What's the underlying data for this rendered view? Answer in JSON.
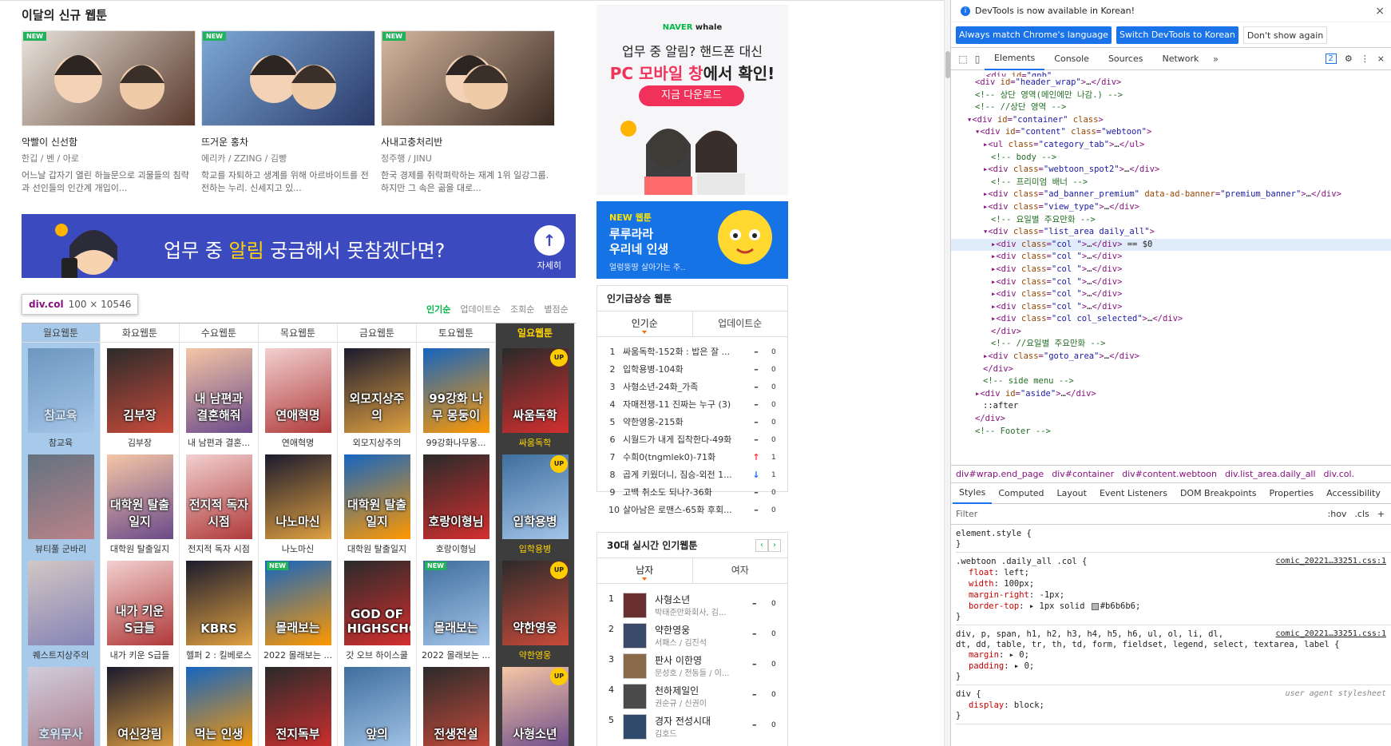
{
  "new_section": {
    "title": "이달의 신규 웹툰",
    "items": [
      {
        "badge": "NEW",
        "title": "악빨이 신선함",
        "author": "한깁 / 벤 / 아로",
        "desc": "어느날 갑자기 열린 하늘문으로 괴물들의 침략과 선인들의 인간계 개입이..."
      },
      {
        "badge": "NEW",
        "title": "뜨거운 홍차",
        "author": "에리카 / ZZING / 김빵",
        "desc": "학교를 자퇴하고 생계를 위해 아르바이트를 전전하는 누리. 신세지고 있..."
      },
      {
        "badge": "NEW",
        "title": "사내고충처리반",
        "author": "정주행 / JINU",
        "desc": "한국 경제를 쥐락펴락하는 재계 1위 일강그룹. 하지만 그 속은 곪을 대로..."
      }
    ]
  },
  "banner": {
    "text_pre": "업무 중 ",
    "text_hl": "알림",
    "text_post": " 궁금해서 못참겠다면?",
    "button_label": "자세히",
    "button_icon": "↑"
  },
  "tooltip": {
    "name": "div.col",
    "size": "100 × 10546"
  },
  "sort_tabs": [
    "인기순",
    "업데이트순",
    "조회순",
    "별점순"
  ],
  "weekdays": [
    {
      "label": "월요웹툰",
      "items": [
        {
          "cap": "참교육",
          "art": "참교육"
        },
        {
          "cap": "뷰티풀 군바리",
          "art": ""
        },
        {
          "cap": "퀘스트지상주의",
          "art": ""
        },
        {
          "cap": "",
          "art": "호위무사"
        }
      ]
    },
    {
      "label": "화요웹툰",
      "items": [
        {
          "cap": "김부장",
          "art": "김부장"
        },
        {
          "cap": "대학원 탈출일지",
          "art": "대학원 탈출일지"
        },
        {
          "cap": "내가 키운 S급들",
          "art": "내가 키운 S급들"
        },
        {
          "cap": "",
          "art": "여신강림"
        }
      ]
    },
    {
      "label": "수요웹툰",
      "items": [
        {
          "cap": "내 남편과 결혼...",
          "art": "내 남편과 결혼해줘"
        },
        {
          "cap": "전지적 독자 시점",
          "art": "전지적 독자 시점"
        },
        {
          "cap": "헬퍼 2 : 킬베로스",
          "art": "KBRS"
        },
        {
          "cap": "",
          "art": "먹는 인생"
        }
      ]
    },
    {
      "label": "목요웹툰",
      "items": [
        {
          "cap": "연애혁명",
          "art": "연애혁명"
        },
        {
          "cap": "나노마신",
          "art": "나노마신"
        },
        {
          "cap": "2022 몰래보는 ...",
          "art": "몰래보는"
        },
        {
          "cap": "",
          "art": "전지독부"
        }
      ]
    },
    {
      "label": "금요웹툰",
      "items": [
        {
          "cap": "외모지상주의",
          "art": "외모지상주의"
        },
        {
          "cap": "대학원 탈출일지",
          "art": "대학원 탈출일지"
        },
        {
          "cap": "갓 오브 하이스쿨",
          "art": "GOD OF HIGHSCHOOL"
        },
        {
          "cap": "",
          "art": "앞의"
        }
      ]
    },
    {
      "label": "토요웹툰",
      "items": [
        {
          "cap": "99강화나무몽...",
          "art": "99강화 나무 몽둥이"
        },
        {
          "cap": "호랑이형님",
          "art": "호랑이형님"
        },
        {
          "cap": "2022 몰래보는 ...",
          "art": "몰래보는"
        },
        {
          "cap": "",
          "art": "전생전설"
        }
      ]
    },
    {
      "label": "일요웹툰",
      "items": [
        {
          "cap": "싸움독학",
          "art": "싸움독학"
        },
        {
          "cap": "입학용병",
          "art": "입학용병"
        },
        {
          "cap": "약한영웅",
          "art": "약한영웅"
        },
        {
          "cap": "",
          "art": "사형소년"
        }
      ]
    }
  ],
  "whale_ad": {
    "brand_pre": "NAVER",
    "brand": "whale",
    "line1": "업무 중 알림? 핸드폰 대신",
    "line2_red": "PC 모바일 창",
    "line2_rest": "에서 확인!",
    "download": "지금 다운로드"
  },
  "promo": {
    "tag": "NEW 웹툰",
    "title1": "루루라라",
    "title2": "우리네 인생",
    "sub": "얼렁뚱땅 살아가는 주.."
  },
  "rising": {
    "title": "인기급상승 웹툰",
    "tabs": [
      "인기순",
      "업데이트순"
    ],
    "rows": [
      {
        "n": "1",
        "t": "싸움독학-152화 : 밥은 잘 ...",
        "ch": "–",
        "cnt": "0"
      },
      {
        "n": "2",
        "t": "입학용병-104화",
        "ch": "–",
        "cnt": "0"
      },
      {
        "n": "3",
        "t": "사형소년-24화_가족",
        "ch": "–",
        "cnt": "0"
      },
      {
        "n": "4",
        "t": "자매전쟁-11 진짜는 누구 (3)",
        "ch": "–",
        "cnt": "0"
      },
      {
        "n": "5",
        "t": "약한영웅-215화",
        "ch": "–",
        "cnt": "0"
      },
      {
        "n": "6",
        "t": "시월드가 내게 집착한다-49화",
        "ch": "–",
        "cnt": "0"
      },
      {
        "n": "7",
        "t": "수희0(tngmlek0)-71화",
        "ch": "↑",
        "cnt": "1"
      },
      {
        "n": "8",
        "t": "곱게 키웠더니, 짐승-외전 1...",
        "ch": "↓",
        "cnt": "1"
      },
      {
        "n": "9",
        "t": "고백 취소도 되나?-36화",
        "ch": "–",
        "cnt": "0"
      },
      {
        "n": "10",
        "t": "살아남은 로맨스-65화 후회...",
        "ch": "–",
        "cnt": "0"
      }
    ]
  },
  "age30": {
    "title": "30대 실시간 인기웹툰",
    "prev": "‹",
    "next": "›",
    "tabs": [
      "남자",
      "여자"
    ],
    "rows": [
      {
        "n": "1",
        "t": "사형소년",
        "a": "박태준만화회사, 김...",
        "ch": "–",
        "cnt": "0"
      },
      {
        "n": "2",
        "t": "약한영웅",
        "a": "서패스 / 김진석",
        "ch": "–",
        "cnt": "0"
      },
      {
        "n": "3",
        "t": "판사 이한영",
        "a": "문성호 / 전동들 / 이...",
        "ch": "–",
        "cnt": "0"
      },
      {
        "n": "4",
        "t": "천하제일인",
        "a": "권순규 / 신권이",
        "ch": "–",
        "cnt": "0"
      },
      {
        "n": "5",
        "t": "경자 전성시대",
        "a": "김호드",
        "ch": "–",
        "cnt": "0"
      }
    ]
  },
  "devtools": {
    "info": "DevTools is now available in Korean!",
    "info_icon": "i",
    "btn_match": "Always match Chrome's language",
    "btn_switch": "Switch DevTools to Korean",
    "btn_dont": "Don't show again",
    "close_icon": "×",
    "tabs": [
      "Elements",
      "Console",
      "Sources",
      "Network"
    ],
    "more": "»",
    "issues": "2",
    "tree": [
      {
        "html": "<span class='tg'>&lt;div</span> <span class='at'>id</span>=<span class='av'>\"header_wrap\"</span><span class='tg'>&gt;</span><span class='tx'>…</span><span class='tg'>&lt;/div&gt;</span>",
        "indent": 3
      },
      {
        "html": "<span class='cm'>&lt;!-- 상단 영역(메인에만 나감.) --&gt;</span>",
        "indent": 3
      },
      {
        "html": "<span class='cm'>&lt;!-- //상단 영역 --&gt;</span>",
        "indent": 3
      },
      {
        "html": "<span class='tg'>▾&lt;div</span> <span class='at'>id</span>=<span class='av'>\"container\"</span> <span class='at'>class</span><span class='tg'>&gt;</span>",
        "indent": 2
      },
      {
        "html": "<span class='tg'>▾&lt;div</span> <span class='at'>id</span>=<span class='av'>\"content\"</span> <span class='at'>class</span>=<span class='av'>\"webtoon\"</span><span class='tg'>&gt;</span>",
        "indent": 3
      },
      {
        "html": "<span class='tg'>▸&lt;ul</span> <span class='at'>class</span>=<span class='av'>\"category_tab\"</span><span class='tg'>&gt;</span><span class='tx'>…</span><span class='tg'>&lt;/ul&gt;</span>",
        "indent": 4
      },
      {
        "html": "<span class='cm'>&lt;!-- body --&gt;</span>",
        "indent": 5
      },
      {
        "html": "<span class='tg'>▸&lt;div</span> <span class='at'>class</span>=<span class='av'>\"webtoon_spot2\"</span><span class='tg'>&gt;</span><span class='tx'>…</span><span class='tg'>&lt;/div&gt;</span>",
        "indent": 4
      },
      {
        "html": "<span class='cm'>&lt;!-- 프리미엄 배너 --&gt;</span>",
        "indent": 5
      },
      {
        "html": "<span class='tg'>▸&lt;div</span> <span class='at'>class</span>=<span class='av'>\"ad_banner_premium\"</span> <span class='at'>data-ad-banner</span>=<span class='av'>\"premium_banner\"</span><span class='tg'>&gt;</span><span class='tx'>…</span><span class='tg'>&lt;/div&gt;</span>",
        "indent": 4
      },
      {
        "html": "<span class='tg'>▸&lt;div</span> <span class='at'>class</span>=<span class='av'>\"view_type\"</span><span class='tg'>&gt;</span><span class='tx'>…</span><span class='tg'>&lt;/div&gt;</span>",
        "indent": 4
      },
      {
        "html": "<span class='cm'>&lt;!-- 요일별 주요만화 --&gt;</span>",
        "indent": 5
      },
      {
        "html": "<span class='tg'>▾&lt;div</span> <span class='at'>class</span>=<span class='av'>\"list_area daily_all\"</span><span class='tg'>&gt;</span>",
        "indent": 4
      },
      {
        "html": "<span class='tg'>▸&lt;div</span> <span class='at'>class</span>=<span class='av'>\"col \"</span><span class='tg'>&gt;</span><span class='tx'>…</span><span class='tg'>&lt;/div&gt;</span> <span class='tx'>== $0</span>",
        "indent": 5,
        "sel": true
      },
      {
        "html": "<span class='tg'>▸&lt;div</span> <span class='at'>class</span>=<span class='av'>\"col \"</span><span class='tg'>&gt;</span><span class='tx'>…</span><span class='tg'>&lt;/div&gt;</span>",
        "indent": 5
      },
      {
        "html": "<span class='tg'>▸&lt;div</span> <span class='at'>class</span>=<span class='av'>\"col \"</span><span class='tg'>&gt;</span><span class='tx'>…</span><span class='tg'>&lt;/div&gt;</span>",
        "indent": 5
      },
      {
        "html": "<span class='tg'>▸&lt;div</span> <span class='at'>class</span>=<span class='av'>\"col \"</span><span class='tg'>&gt;</span><span class='tx'>…</span><span class='tg'>&lt;/div&gt;</span>",
        "indent": 5
      },
      {
        "html": "<span class='tg'>▸&lt;div</span> <span class='at'>class</span>=<span class='av'>\"col \"</span><span class='tg'>&gt;</span><span class='tx'>…</span><span class='tg'>&lt;/div&gt;</span>",
        "indent": 5
      },
      {
        "html": "<span class='tg'>▸&lt;div</span> <span class='at'>class</span>=<span class='av'>\"col \"</span><span class='tg'>&gt;</span><span class='tx'>…</span><span class='tg'>&lt;/div&gt;</span>",
        "indent": 5
      },
      {
        "html": "<span class='tg'>▸&lt;div</span> <span class='at'>class</span>=<span class='av'>\"col col_selected\"</span><span class='tg'>&gt;</span><span class='tx'>…</span><span class='tg'>&lt;/div&gt;</span>",
        "indent": 5
      },
      {
        "html": "<span class='tg'>&lt;/div&gt;</span>",
        "indent": 5
      },
      {
        "html": "<span class='cm'>&lt;!-- //요일별 주요만화 --&gt;</span>",
        "indent": 5
      },
      {
        "html": "<span class='tg'>▸&lt;div</span> <span class='at'>class</span>=<span class='av'>\"goto_area\"</span><span class='tg'>&gt;</span><span class='tx'>…</span><span class='tg'>&lt;/div&gt;</span>",
        "indent": 4
      },
      {
        "html": "<span class='tg'>&lt;/div&gt;</span>",
        "indent": 4
      },
      {
        "html": "<span class='cm'>&lt;!-- side menu --&gt;</span>",
        "indent": 4
      },
      {
        "html": "<span class='tg'>▸&lt;div</span> <span class='at'>id</span>=<span class='av'>\"aside\"</span><span class='tg'>&gt;</span><span class='tx'>…</span><span class='tg'>&lt;/div&gt;</span>",
        "indent": 3
      },
      {
        "html": "<span class='tx'>::after</span>",
        "indent": 4
      },
      {
        "html": "<span class='tg'>&lt;/div&gt;</span>",
        "indent": 3
      },
      {
        "html": "<span class='cm'>&lt;!-- Footer --&gt;</span>",
        "indent": 3
      }
    ],
    "crumbs": [
      "div#wrap.end_page",
      "div#container",
      "div#content.webtoon",
      "div.list_area.daily_all",
      "div.col."
    ],
    "subtabs": [
      "Styles",
      "Computed",
      "Layout",
      "Event Listeners",
      "DOM Breakpoints",
      "Properties",
      "Accessibility"
    ],
    "filter": "Filter",
    "filter_tools": [
      ":hov",
      ".cls",
      "+"
    ],
    "element_style": "element.style {",
    "rule1_sel": ".webtoon .daily_all .col {",
    "rule1_src": "comic_20221…33251.css:1",
    "rule1_props": [
      [
        "float",
        "left"
      ],
      [
        "width",
        "100px"
      ],
      [
        "margin-right",
        "-1px"
      ],
      [
        "border-top",
        "▸ 1px solid #b6b6b6"
      ]
    ],
    "rule2_sel1": "div, p, span, h1, h2, h3, h4, h5, h6, ul, ol, li, dl,",
    "rule2_sel2": "dt, dd, table, tr, th, td, form, fieldset, legend, select, textarea, label {",
    "rule2_src": "comic_20221…33251.css:1",
    "rule2_props": [
      [
        "margin",
        "▸ 0"
      ],
      [
        "padding",
        "▸ 0"
      ]
    ],
    "rule3_sel": "div {",
    "rule3_src": "user agent stylesheet",
    "rule3_props": [
      [
        "display",
        "block"
      ]
    ],
    "close_brace": "}"
  }
}
